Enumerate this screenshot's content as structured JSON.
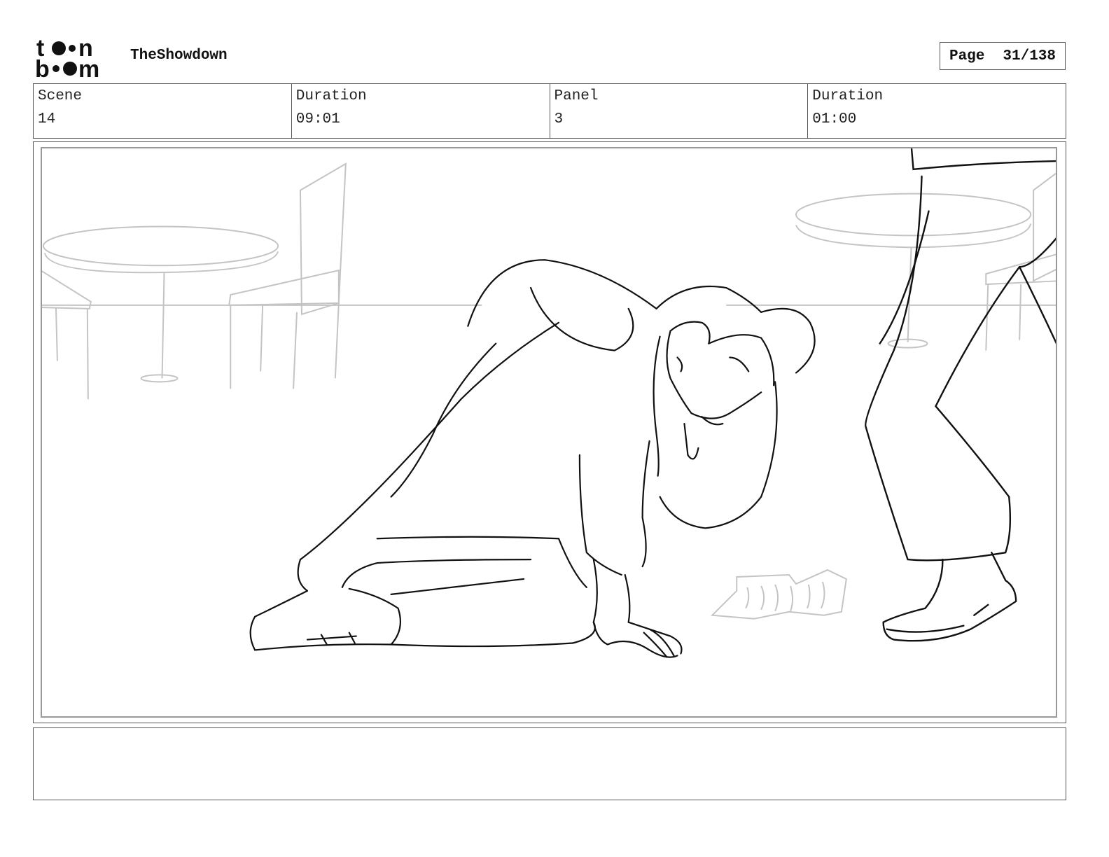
{
  "header": {
    "logo_text": "toon boom",
    "project_title": "TheShowdown",
    "page_label": "Page",
    "page_value": "31/138"
  },
  "info": {
    "scene_label": "Scene",
    "scene_value": "14",
    "scene_duration_label": "Duration",
    "scene_duration_value": "09:01",
    "panel_label": "Panel",
    "panel_value": "3",
    "panel_duration_label": "Duration",
    "panel_duration_value": "01:00"
  },
  "notes": {
    "dialogue": ""
  }
}
